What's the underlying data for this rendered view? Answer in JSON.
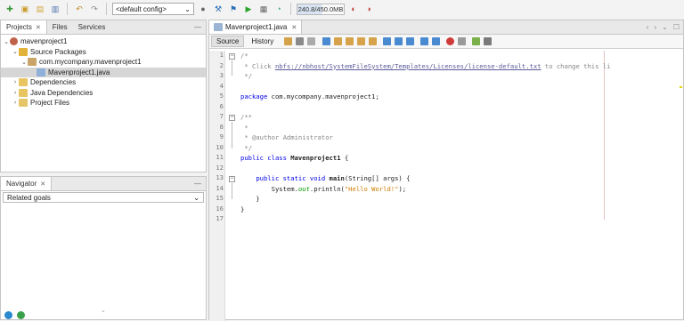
{
  "toolbar": {
    "config_value": "<default config>",
    "memory": "240.8/450.0MB"
  },
  "projects_panel": {
    "tabs": [
      "Projects",
      "Files",
      "Services"
    ],
    "tree": [
      {
        "label": "mavenproject1",
        "level": 0,
        "icon": "project-icon",
        "expanded": true
      },
      {
        "label": "Source Packages",
        "level": 1,
        "icon": "source-packages-icon",
        "expanded": true
      },
      {
        "label": "com.mycompany.mavenproject1",
        "level": 2,
        "icon": "package-icon",
        "expanded": true
      },
      {
        "label": "Mavenproject1.java",
        "level": 3,
        "icon": "java-file-icon",
        "selected": true
      },
      {
        "label": "Dependencies",
        "level": 1,
        "icon": "dependencies-icon",
        "expanded": false
      },
      {
        "label": "Java Dependencies",
        "level": 1,
        "icon": "java-dependencies-icon",
        "expanded": false
      },
      {
        "label": "Project Files",
        "level": 1,
        "icon": "project-files-icon",
        "expanded": false
      }
    ]
  },
  "navigator": {
    "tab": "Navigator",
    "select_value": "Related goals"
  },
  "editor": {
    "tab_title": "Mavenproject1.java",
    "source_label": "Source",
    "history_label": "History",
    "code_lines": [
      "/*",
      " * Click nbfs://nbhost/SystemFileSystem/Templates/Licenses/license-default.txt to change this li",
      " */",
      "",
      "package com.mycompany.mavenproject1;",
      "",
      "/**",
      " *",
      " * @author Administrator",
      " */",
      "public class Mavenproject1 {",
      "",
      "    public static void main(String[] args) {",
      "        System.out.println(\"Hello World!\");",
      "    }",
      "}",
      ""
    ]
  },
  "colors": {
    "keyword": "#0000e6",
    "string": "#ce7b00",
    "comment": "#888888"
  }
}
